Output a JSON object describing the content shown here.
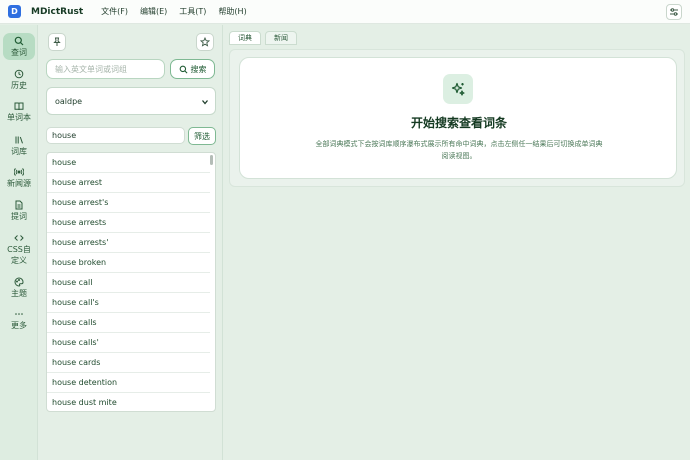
{
  "titlebar": {
    "logo": "D",
    "app_title": "MDictRust",
    "menu": [
      "文件(F)",
      "编辑(E)",
      "工具(T)",
      "帮助(H)"
    ],
    "right_icon": "sliders-icon"
  },
  "nav": {
    "items": [
      {
        "label": "查词",
        "icon": "search-icon",
        "active": true
      },
      {
        "label": "历史",
        "icon": "history-icon"
      },
      {
        "label": "单词本",
        "icon": "book-icon"
      },
      {
        "label": "词库",
        "icon": "library-icon"
      },
      {
        "label": "新闻源",
        "icon": "broadcast-icon"
      },
      {
        "label": "提词",
        "icon": "document-icon"
      },
      {
        "label": "CSS自定义",
        "icon": "code-icon"
      },
      {
        "label": "主题",
        "icon": "palette-icon"
      },
      {
        "label": "更多",
        "icon": "more-icon"
      }
    ]
  },
  "left": {
    "pin_icon": "pin-icon",
    "star_icon": "star-icon",
    "search": {
      "placeholder": "输入英文单词或词组",
      "value": "",
      "button_label": "搜索"
    },
    "dictionary": {
      "selected": "oaldpe"
    },
    "filter": {
      "value": "house",
      "button_label": "筛选"
    },
    "words": [
      "house",
      "house arrest",
      "house arrest's",
      "house arrests",
      "house arrests'",
      "house broken",
      "house call",
      "house call's",
      "house calls",
      "house calls'",
      "house cards",
      "house detention",
      "house dust mite"
    ]
  },
  "main": {
    "tabs": [
      {
        "label": "词典",
        "active": true
      },
      {
        "label": "新闻",
        "active": false
      }
    ],
    "card": {
      "icon": "sparkles-icon",
      "title": "开始搜索查看词条",
      "desc": "全部词典模式下会按词库顺序瀑布式展示所有命中词典，点击左侧任一结果后可切换成单词典阅读视图。"
    }
  },
  "colors": {
    "accent": "#2f7a46",
    "logo_blue": "#2f6fe0",
    "active_nav": "#b7dcc3"
  }
}
